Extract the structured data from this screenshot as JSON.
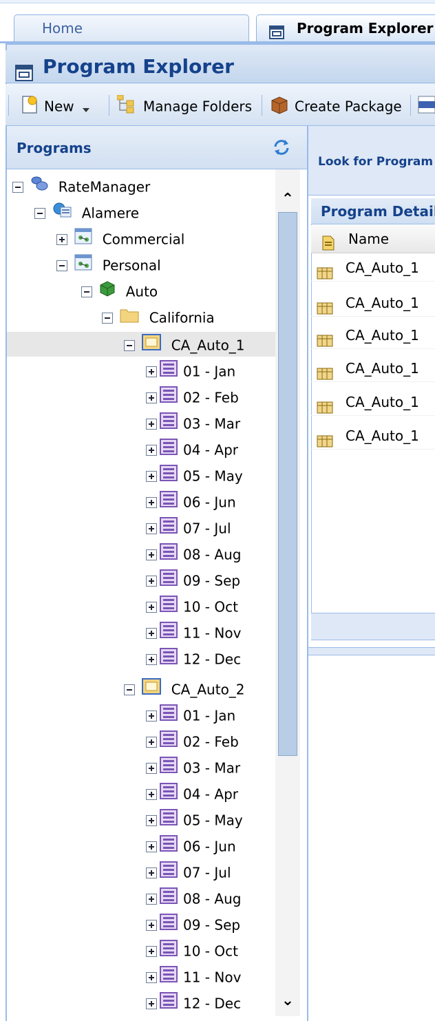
{
  "tabs": {
    "home_label": "Home",
    "program_explorer_label": "Program Explorer"
  },
  "window": {
    "title": "Program Explorer"
  },
  "toolbar": {
    "new_label": "New",
    "manage_folders_label": "Manage Folders",
    "create_package_label": "Create Package"
  },
  "programs_panel": {
    "title": "Programs",
    "tree": {
      "root": "RateManager",
      "company": "Alamere",
      "line_commercial": "Commercial",
      "line_personal": "Personal",
      "product": "Auto",
      "state": "California",
      "program1": "CA_Auto_1",
      "program2": "CA_Auto_2",
      "months": [
        "01 - Jan",
        "02 - Feb",
        "03 - Mar",
        "04 - Apr",
        "05 - May",
        "06 - Jun",
        "07 - Jul",
        "08 - Aug",
        "09 - Sep",
        "10 - Oct",
        "11 - Nov",
        "12 - Dec"
      ]
    }
  },
  "right_panel": {
    "look_for_label": "Look for Program",
    "detail_title": "Program Detail",
    "column_name": "Name",
    "rows": [
      "CA_Auto_1",
      "CA_Auto_1",
      "CA_Auto_1",
      "CA_Auto_1",
      "CA_Auto_1",
      "CA_Auto_1"
    ]
  },
  "colors": {
    "header_text": "#15428b",
    "panel_border": "#99bbe8",
    "panel_background": "#dfe8f6",
    "selected_row": "#e7e7e7"
  }
}
